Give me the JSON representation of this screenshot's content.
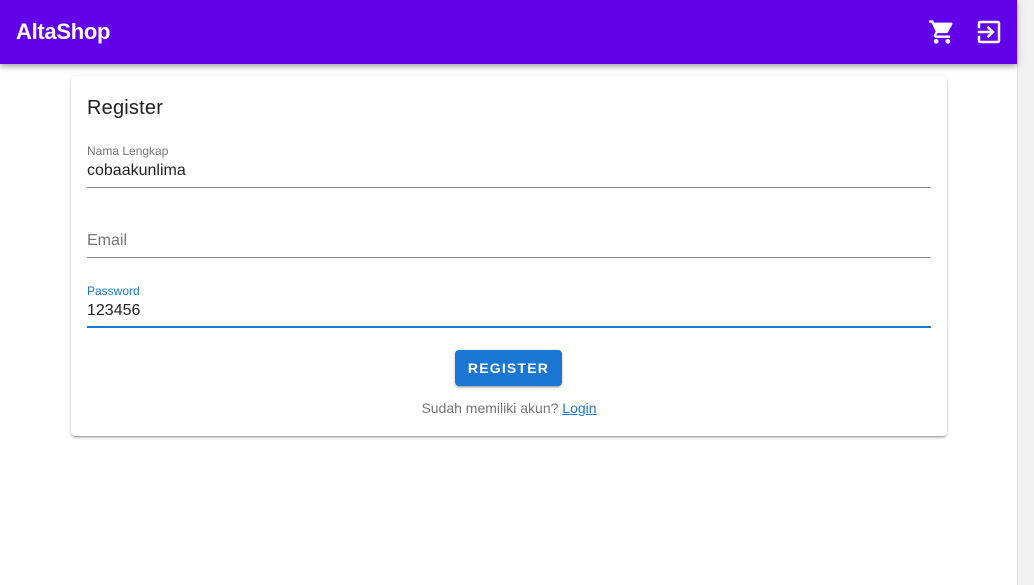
{
  "app": {
    "title": "AltaShop",
    "icons": {
      "cart": "cart-icon",
      "login": "login-icon"
    },
    "colors": {
      "appbar": "#6200ea",
      "primary": "#1976d2"
    }
  },
  "card": {
    "title": "Register",
    "fields": {
      "name": {
        "label": "Nama Lengkap",
        "value": "cobaakunlima"
      },
      "email": {
        "label": "Email",
        "placeholder": "Email",
        "value": ""
      },
      "password": {
        "label": "Password",
        "value": "123456"
      }
    },
    "register_label": "REGISTER",
    "footer_prefix": "Sudah memiliki akun?",
    "login_link": "Login"
  }
}
